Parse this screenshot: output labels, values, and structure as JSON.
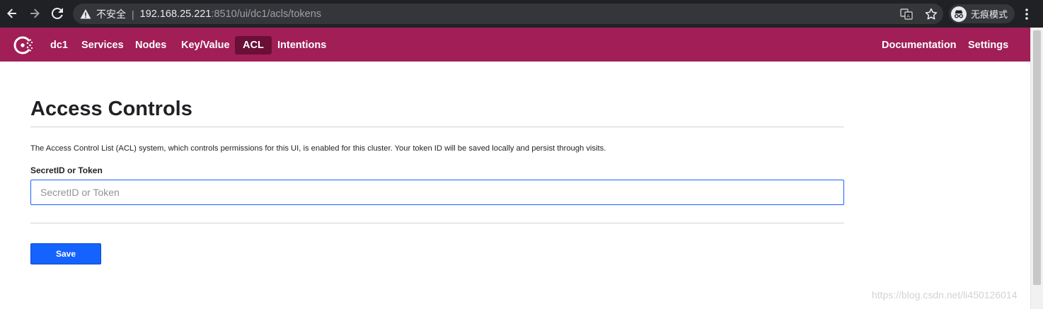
{
  "browser": {
    "security_label": "不安全",
    "separator": "|",
    "url_host": "192.168.25.221",
    "url_rest": ":8510/ui/dc1/acls/tokens",
    "incognito_label": "无痕模式"
  },
  "header": {
    "datacenter": "dc1",
    "nav": {
      "services": "Services",
      "nodes": "Nodes",
      "key_value": "Key/Value",
      "acl": "ACL",
      "intentions": "Intentions",
      "documentation": "Documentation",
      "settings": "Settings"
    },
    "active_nav": "ACL",
    "brand_color": "#a11e56"
  },
  "main": {
    "title": "Access Controls",
    "description": "The Access Control List (ACL) system, which controls permissions for this UI, is enabled for this cluster. Your token ID will be saved locally and persist through visits.",
    "field_label": "SecretID or Token",
    "input_placeholder": "SecretID or Token",
    "input_value": "",
    "save_label": "Save"
  },
  "watermark": "https://blog.csdn.net/li450126014"
}
